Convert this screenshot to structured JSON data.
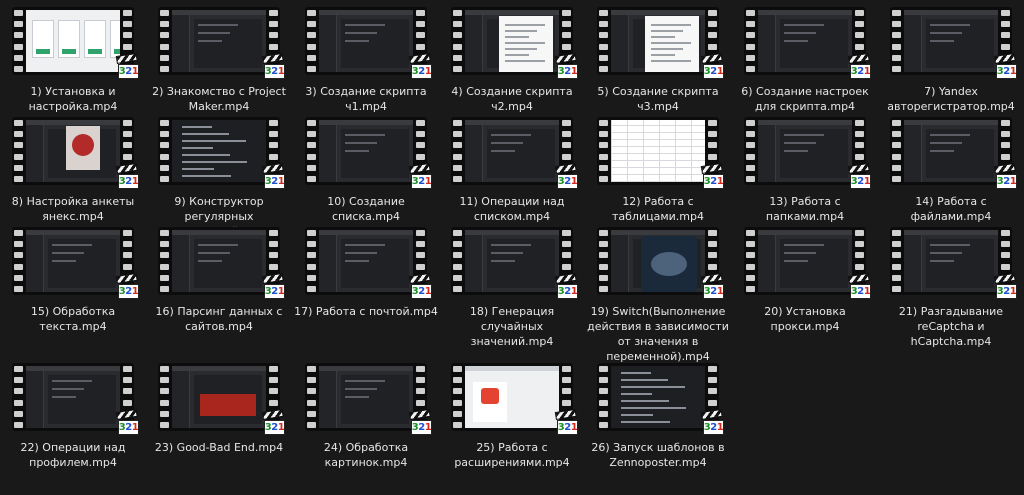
{
  "colors": {
    "background": "#191919",
    "caption": "#e6e6e6",
    "badge_digit_1": "#1c8f2a",
    "badge_digit_2": "#1f4fd1",
    "badge_digit_3": "#d12a1f"
  },
  "badge_icon": "media-player-classic-321-icon",
  "files": [
    {
      "name": "1) Установка и настройка.mp4",
      "thumb": "pricing"
    },
    {
      "name": "2) Знакомство с Project Maker.mp4",
      "thumb": "dark"
    },
    {
      "name": "3) Создание скрипта ч1.mp4",
      "thumb": "dark"
    },
    {
      "name": "4) Создание скрипта ч2.mp4",
      "thumb": "doc"
    },
    {
      "name": "5) Создание скрипта ч3.mp4",
      "thumb": "doc"
    },
    {
      "name": "6) Создание настроек для скрипта.mp4",
      "thumb": "dark"
    },
    {
      "name": "7) Yandex авторегистратор.mp4",
      "thumb": "dark"
    },
    {
      "name": "8) Настройка анкеты янекс.mp4",
      "thumb": "photo"
    },
    {
      "name": "9) Конструктор регулярных выражений.mp4",
      "thumb": "code"
    },
    {
      "name": "10) Создание списка.mp4",
      "thumb": "dark"
    },
    {
      "name": "11) Операции над списком.mp4",
      "thumb": "dark"
    },
    {
      "name": "12) Работа с таблицами.mp4",
      "thumb": "sheet"
    },
    {
      "name": "13) Работа с папками.mp4",
      "thumb": "dark"
    },
    {
      "name": "14) Работа с файлами.mp4",
      "thumb": "dark"
    },
    {
      "name": "15) Обработка текста.mp4",
      "thumb": "dark"
    },
    {
      "name": "16) Парсинг данных с сайтов.mp4",
      "thumb": "dark"
    },
    {
      "name": "17) Работа с почтой.mp4",
      "thumb": "dark"
    },
    {
      "name": "18) Генерация случайных значений.mp4",
      "thumb": "dark"
    },
    {
      "name": "19) Switch(Выполнение действия в зависимости от значения в переменной).mp4",
      "thumb": "modal"
    },
    {
      "name": "20) Установка прокси.mp4",
      "thumb": "dark"
    },
    {
      "name": "21) Разгадывание reCaptcha и hCaptcha.mp4",
      "thumb": "dark"
    },
    {
      "name": "22) Операции над профилем.mp4",
      "thumb": "dark"
    },
    {
      "name": "23) Good-Bad End.mp4",
      "thumb": "red"
    },
    {
      "name": "24) Обработка картинок.mp4",
      "thumb": "dark"
    },
    {
      "name": "25) Работа с расширениями.mp4",
      "thumb": "todo"
    },
    {
      "name": "26) Запуск шаблонов в Zennoposter.mp4",
      "thumb": "code"
    }
  ]
}
